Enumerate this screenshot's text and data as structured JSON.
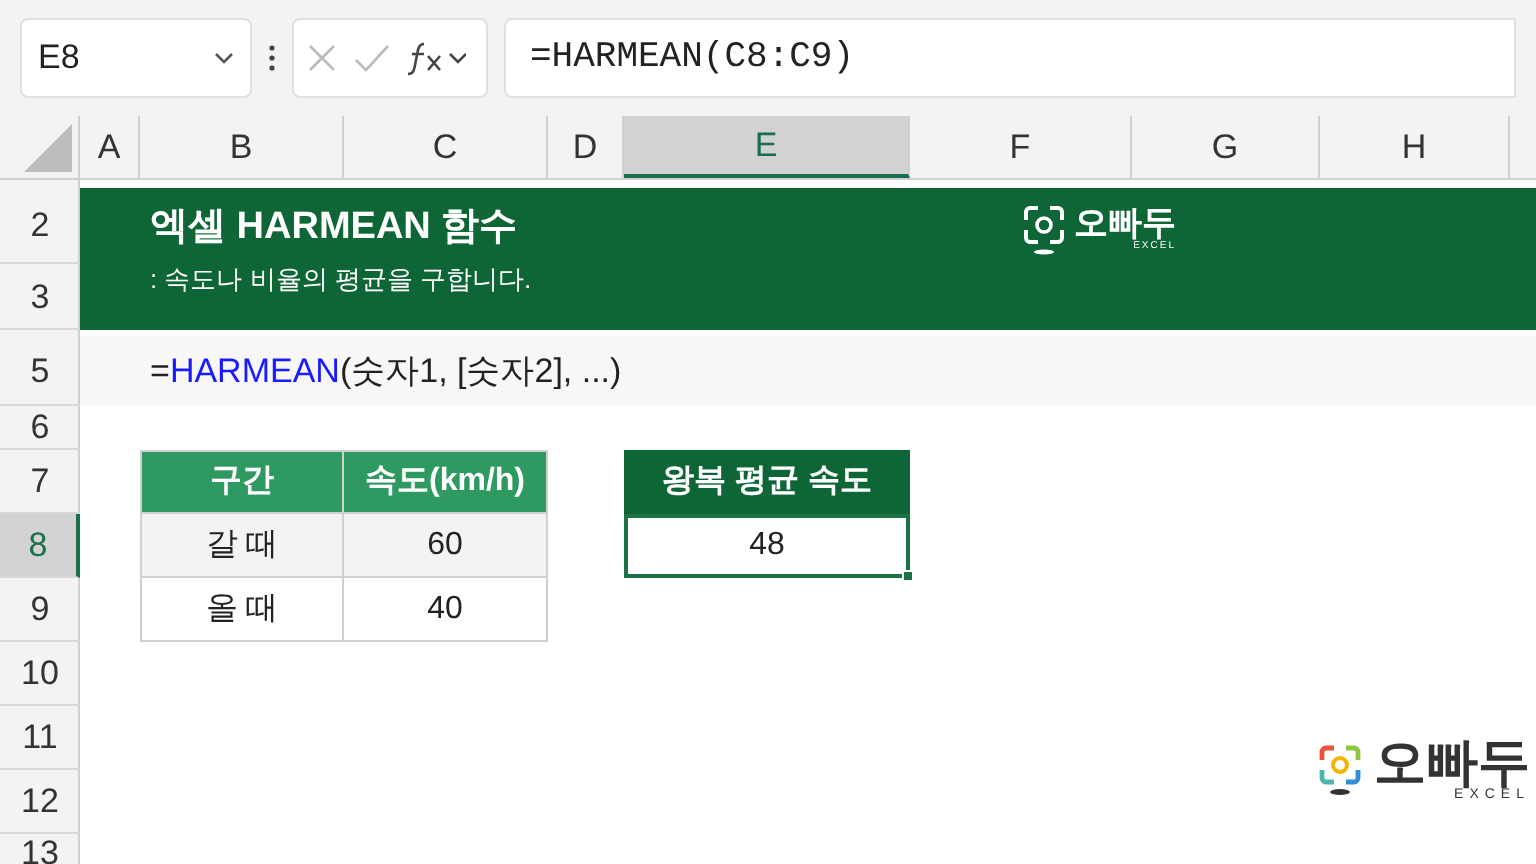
{
  "name_box": {
    "value": "E8"
  },
  "formula_bar": {
    "value": "=HARMEAN(C8:C9)"
  },
  "columns": [
    {
      "label": "A",
      "selected": false
    },
    {
      "label": "B",
      "selected": false
    },
    {
      "label": "C",
      "selected": false
    },
    {
      "label": "D",
      "selected": false
    },
    {
      "label": "E",
      "selected": true
    },
    {
      "label": "F",
      "selected": false
    },
    {
      "label": "G",
      "selected": false
    },
    {
      "label": "H",
      "selected": false
    }
  ],
  "rows": [
    {
      "label": "2",
      "selected": false
    },
    {
      "label": "3",
      "selected": false
    },
    {
      "label": "5",
      "selected": false
    },
    {
      "label": "6",
      "selected": false
    },
    {
      "label": "7",
      "selected": false
    },
    {
      "label": "8",
      "selected": true
    },
    {
      "label": "9",
      "selected": false
    },
    {
      "label": "10",
      "selected": false
    },
    {
      "label": "11",
      "selected": false
    },
    {
      "label": "12",
      "selected": false
    },
    {
      "label": "13",
      "selected": false
    }
  ],
  "banner": {
    "title": "엑셀 HARMEAN 함수",
    "subtitle": ": 속도나 비율의 평균을 구합니다.",
    "logo": {
      "text": "오빠두",
      "subtext": "EXCEL"
    }
  },
  "syntax": {
    "prefix": "=",
    "function": "HARMEAN",
    "args": "(숫자1, [숫자2], ...)"
  },
  "table": {
    "columns": [
      "구간",
      "속도(km/h)"
    ],
    "rows": [
      [
        "갈 때",
        "60"
      ],
      [
        "올 때",
        "40"
      ]
    ]
  },
  "result": {
    "header": "왕복 평균 속도",
    "value": "48",
    "selected": true
  },
  "footer_logo": {
    "text": "오빠두",
    "subtext": "EXCEL"
  }
}
